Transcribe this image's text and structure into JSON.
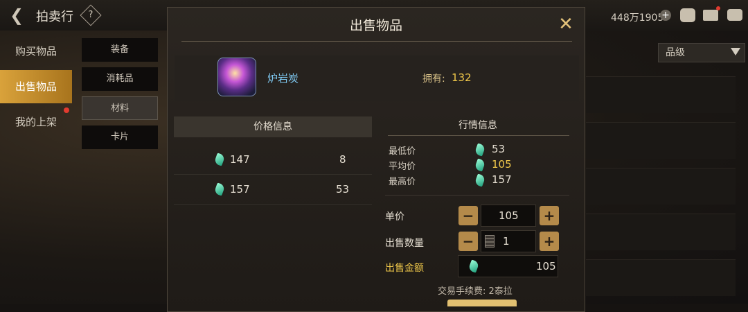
{
  "header": {
    "title": "拍卖行",
    "help_icon": "?",
    "currency": "448万1905"
  },
  "nav": {
    "items": [
      {
        "label": "购买物品"
      },
      {
        "label": "出售物品"
      },
      {
        "label": "我的上架"
      }
    ]
  },
  "subnav": {
    "items": [
      {
        "label": "装备"
      },
      {
        "label": "消耗品"
      },
      {
        "label": "材料"
      },
      {
        "label": "卡片"
      }
    ]
  },
  "filter": {
    "grade": "品级"
  },
  "modal": {
    "title": "出售物品",
    "item_name": "炉岩炭",
    "own_label": "拥有:",
    "own_value": "132",
    "price_info_title": "价格信息",
    "listings": [
      {
        "price": "147",
        "qty": "8"
      },
      {
        "price": "157",
        "qty": "53"
      }
    ],
    "market_title": "行情信息",
    "market": {
      "min_label": "最低价",
      "min_value": "53",
      "avg_label": "平均价",
      "avg_value": "105",
      "max_label": "最高价",
      "max_value": "157"
    },
    "unit_price_label": "单价",
    "unit_price": "105",
    "qty_label": "出售数量",
    "qty": "1",
    "total_label": "出售金额",
    "total": "105",
    "minus": "−",
    "plus": "+",
    "fee_text": "交易手续费: 2泰拉"
  }
}
